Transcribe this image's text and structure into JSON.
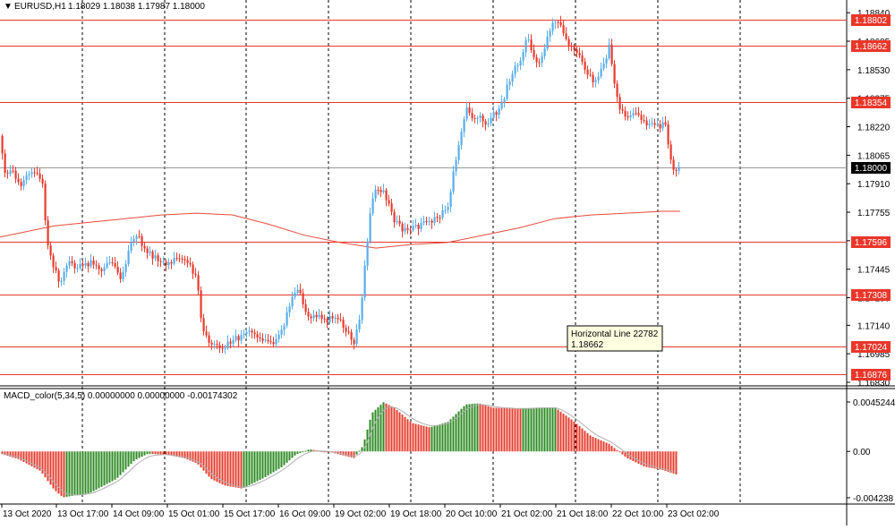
{
  "header": {
    "arrow": "▼",
    "symbol_timeframe": "EURUSD,H1",
    "ohlc": "1.18029 1.18038 1.17987 1.18000"
  },
  "price_axis_ticks": [
    "1.18840",
    "1.18685",
    "1.18530",
    "1.18375",
    "1.18220",
    "1.18065",
    "1.17910",
    "1.17755",
    "1.17600",
    "1.17445",
    "1.17290",
    "1.17140",
    "1.16985",
    "1.16830"
  ],
  "current_price_label": "1.18000",
  "horizontal_lines": [
    {
      "price": 1.18802,
      "label": "1.18802"
    },
    {
      "price": 1.18662,
      "label": "1.18662"
    },
    {
      "price": 1.18354,
      "label": "1.18354"
    },
    {
      "price": 1.17596,
      "label": "1.17596"
    },
    {
      "price": 1.17308,
      "label": "1.17308"
    },
    {
      "price": 1.17024,
      "label": "1.17024"
    },
    {
      "price": 1.16876,
      "label": "1.16876"
    }
  ],
  "tooltip": {
    "title": "Horizontal Line 22782",
    "value": "1.18662"
  },
  "time_axis_labels": [
    "13 Oct 2020",
    "13 Oct 17:00",
    "14 Oct 09:00",
    "15 Oct 01:00",
    "15 Oct 17:00",
    "16 Oct 09:00",
    "19 Oct 02:00",
    "19 Oct 18:00",
    "20 Oct 10:00",
    "21 Oct 02:00",
    "21 Oct 18:00",
    "22 Oct 10:00",
    "23 Oct 02:00"
  ],
  "macd": {
    "title": "MACD_color(5,34,5) 0.00000000 0.00000000 -0.00174302",
    "axis_ticks": [
      "0.0045244",
      "0.00",
      "-0.004238"
    ]
  },
  "colors": {
    "bull": "#5aaeea",
    "bear": "#e63c2e",
    "hline": "#e8372a",
    "ma": "#e84a3a",
    "macd_up": "#2e8b23",
    "macd_down": "#e63c2e",
    "signal": "#b0b0b0"
  },
  "chart_data": {
    "type": "candlestick",
    "symbol": "EURUSD",
    "timeframe": "H1",
    "ylim": [
      1.1683,
      1.1888
    ],
    "current_price": 1.18,
    "price_path": [
      [
        0,
        1.1817
      ],
      [
        5,
        1.1797
      ],
      [
        14,
        1.1797
      ],
      [
        22,
        1.1789
      ],
      [
        30,
        1.1797
      ],
      [
        38,
        1.1797
      ],
      [
        47,
        1.1791
      ],
      [
        52,
        1.1759
      ],
      [
        60,
        1.1745
      ],
      [
        67,
        1.1737
      ],
      [
        75,
        1.1749
      ],
      [
        85,
        1.1745
      ],
      [
        100,
        1.1748
      ],
      [
        112,
        1.1745
      ],
      [
        125,
        1.1747
      ],
      [
        135,
        1.1738
      ],
      [
        145,
        1.1757
      ],
      [
        152,
        1.1764
      ],
      [
        160,
        1.1756
      ],
      [
        170,
        1.1752
      ],
      [
        182,
        1.1748
      ],
      [
        195,
        1.1749
      ],
      [
        205,
        1.1751
      ],
      [
        212,
        1.1746
      ],
      [
        220,
        1.1738
      ],
      [
        225,
        1.1713
      ],
      [
        232,
        1.1705
      ],
      [
        240,
        1.1704
      ],
      [
        248,
        1.1701
      ],
      [
        258,
        1.1705
      ],
      [
        268,
        1.1708
      ],
      [
        280,
        1.1712
      ],
      [
        292,
        1.1705
      ],
      [
        305,
        1.1703
      ],
      [
        315,
        1.1712
      ],
      [
        325,
        1.1728
      ],
      [
        333,
        1.1733
      ],
      [
        342,
        1.1719
      ],
      [
        352,
        1.1719
      ],
      [
        365,
        1.1717
      ],
      [
        375,
        1.1719
      ],
      [
        385,
        1.1712
      ],
      [
        395,
        1.1705
      ],
      [
        402,
        1.1718
      ],
      [
        408,
        1.1751
      ],
      [
        414,
        1.1778
      ],
      [
        420,
        1.1789
      ],
      [
        430,
        1.1785
      ],
      [
        440,
        1.1771
      ],
      [
        450,
        1.1766
      ],
      [
        460,
        1.1766
      ],
      [
        470,
        1.1769
      ],
      [
        480,
        1.1771
      ],
      [
        490,
        1.1773
      ],
      [
        500,
        1.1778
      ],
      [
        505,
        1.1794
      ],
      [
        512,
        1.1812
      ],
      [
        520,
        1.1832
      ],
      [
        527,
        1.1826
      ],
      [
        535,
        1.1829
      ],
      [
        545,
        1.1823
      ],
      [
        552,
        1.1829
      ],
      [
        560,
        1.1834
      ],
      [
        568,
        1.1846
      ],
      [
        575,
        1.1855
      ],
      [
        582,
        1.1859
      ],
      [
        588,
        1.1872
      ],
      [
        595,
        1.1859
      ],
      [
        602,
        1.1857
      ],
      [
        608,
        1.1864
      ],
      [
        615,
        1.1877
      ],
      [
        622,
        1.1882
      ],
      [
        627,
        1.1874
      ],
      [
        632,
        1.1868
      ],
      [
        640,
        1.1866
      ],
      [
        648,
        1.1859
      ],
      [
        655,
        1.1851
      ],
      [
        662,
        1.1847
      ],
      [
        668,
        1.1849
      ],
      [
        675,
        1.1856
      ],
      [
        680,
        1.1865
      ],
      [
        685,
        1.1848
      ],
      [
        692,
        1.1832
      ],
      [
        700,
        1.1826
      ],
      [
        708,
        1.1829
      ],
      [
        715,
        1.1826
      ],
      [
        722,
        1.1823
      ],
      [
        730,
        1.1823
      ],
      [
        737,
        1.1821
      ],
      [
        742,
        1.1825
      ],
      [
        748,
        1.1806
      ],
      [
        752,
        1.1799
      ],
      [
        760,
        1.18
      ]
    ],
    "ma_path": [
      [
        0,
        1.1762
      ],
      [
        60,
        1.1768
      ],
      [
        120,
        1.1771
      ],
      [
        180,
        1.1774
      ],
      [
        220,
        1.1775
      ],
      [
        260,
        1.1774
      ],
      [
        300,
        1.1769
      ],
      [
        340,
        1.1763
      ],
      [
        380,
        1.1759
      ],
      [
        420,
        1.1756
      ],
      [
        460,
        1.1758
      ],
      [
        500,
        1.1759
      ],
      [
        540,
        1.1763
      ],
      [
        580,
        1.1767
      ],
      [
        620,
        1.1772
      ],
      [
        660,
        1.1774
      ],
      [
        700,
        1.1775
      ],
      [
        740,
        1.1776
      ],
      [
        760,
        1.1776
      ]
    ],
    "macd_path": [
      [
        0,
        -0.0002
      ],
      [
        20,
        -0.0007
      ],
      [
        45,
        -0.0018
      ],
      [
        60,
        -0.0035
      ],
      [
        70,
        -0.0042
      ],
      [
        100,
        -0.0038
      ],
      [
        130,
        -0.0025
      ],
      [
        150,
        -0.0008
      ],
      [
        165,
        -0.0002
      ],
      [
        185,
        -0.0003
      ],
      [
        205,
        -0.0006
      ],
      [
        220,
        -0.0011
      ],
      [
        235,
        -0.0025
      ],
      [
        250,
        -0.0031
      ],
      [
        270,
        -0.0034
      ],
      [
        295,
        -0.0024
      ],
      [
        315,
        -0.0014
      ],
      [
        330,
        -0.0003
      ],
      [
        345,
        0.0002
      ],
      [
        370,
        -0.0001
      ],
      [
        395,
        -0.0006
      ],
      [
        405,
        0.0005
      ],
      [
        415,
        0.0035
      ],
      [
        428,
        0.0045
      ],
      [
        440,
        0.004
      ],
      [
        460,
        0.0026
      ],
      [
        480,
        0.0022
      ],
      [
        500,
        0.0027
      ],
      [
        520,
        0.0043
      ],
      [
        535,
        0.0044
      ],
      [
        550,
        0.004
      ],
      [
        580,
        0.0039
      ],
      [
        600,
        0.004
      ],
      [
        620,
        0.004
      ],
      [
        640,
        0.0028
      ],
      [
        660,
        0.0014
      ],
      [
        680,
        0.0007
      ],
      [
        700,
        -0.0006
      ],
      [
        720,
        -0.0014
      ],
      [
        740,
        -0.0017
      ],
      [
        755,
        -0.0021
      ]
    ]
  }
}
